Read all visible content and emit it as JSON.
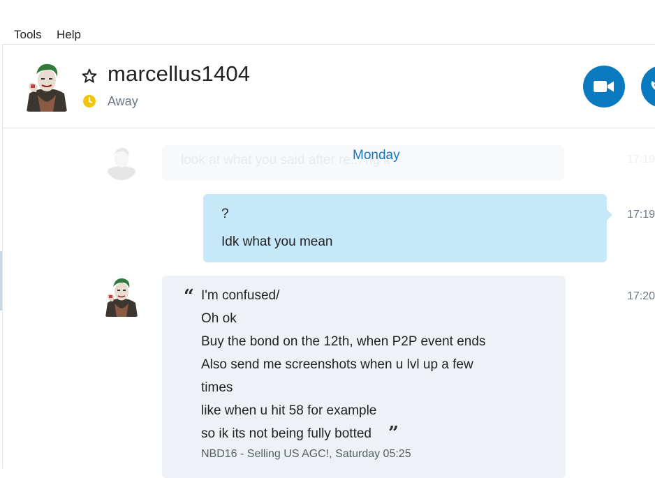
{
  "menu": {
    "items": [
      "Tools",
      "Help"
    ]
  },
  "header": {
    "contact_name": "marcellus1404",
    "status": "Away",
    "avatar_icon": "joker-avatar",
    "favorite_icon": "star-outline-icon",
    "status_icon": "clock-away-icon",
    "video_call_icon": "video-camera-icon",
    "status_color": "#f3c410",
    "accent_color": "#0a7ac0"
  },
  "chat": {
    "day_divider": "Monday",
    "faded_message": {
      "text": "look at what you said after re... ng it",
      "time": "17:19"
    },
    "outgoing": {
      "lines": [
        "?",
        "Idk what you mean"
      ],
      "time": "17:19"
    },
    "incoming": {
      "time": "17:20",
      "quoted_lines": [
        "I'm confused/",
        "Oh ok",
        "Buy the bond on the 12th, when P2P event ends",
        "Also send me screenshots when u lvl up a few",
        "times",
        "like when u hit 58 for example",
        "so ik its not being fully botted"
      ],
      "quote_source": "NBD16 - Selling US AGC!, Saturday 05:25"
    },
    "outgoing_bubble_color": "#c7e8f8",
    "incoming_bubble_color": "#eef1f5",
    "day_color": "#1777bb"
  }
}
